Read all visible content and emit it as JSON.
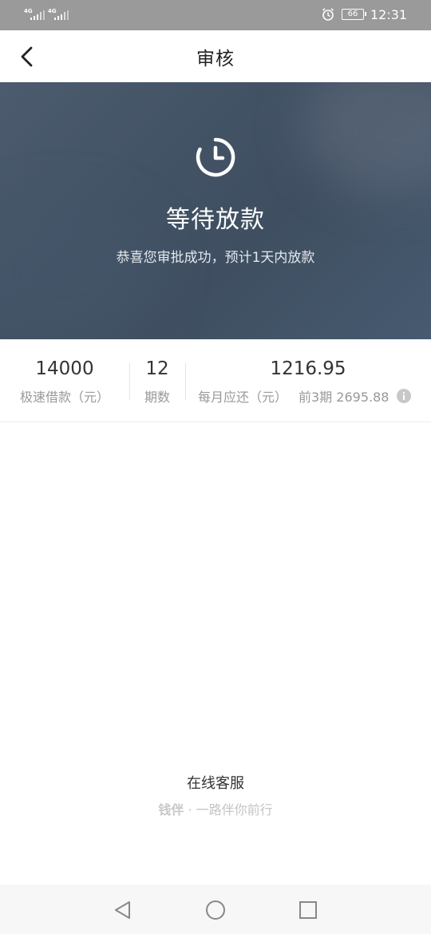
{
  "status_bar": {
    "signal_1": "4G",
    "signal_2": "4G",
    "battery": "66",
    "time": "12:31"
  },
  "nav": {
    "title": "审核",
    "back_icon": "chevron-left-icon"
  },
  "banner": {
    "icon": "clock-icon",
    "title": "等待放款",
    "subtitle": "恭喜您审批成功，预计1天内放款"
  },
  "summary": {
    "amount": {
      "value": "14000",
      "label": "极速借款（元）"
    },
    "periods": {
      "value": "12",
      "label": "期数"
    },
    "monthly": {
      "value": "1216.95",
      "label": "每月应还（元）",
      "first_label": "前3期",
      "first_value": "2695.88"
    }
  },
  "footer": {
    "service": "在线客服",
    "brand": "钱伴",
    "slogan": "· 一路伴你前行"
  },
  "colors": {
    "banner": "#45566a",
    "status_bar": "#9a9a9a"
  }
}
